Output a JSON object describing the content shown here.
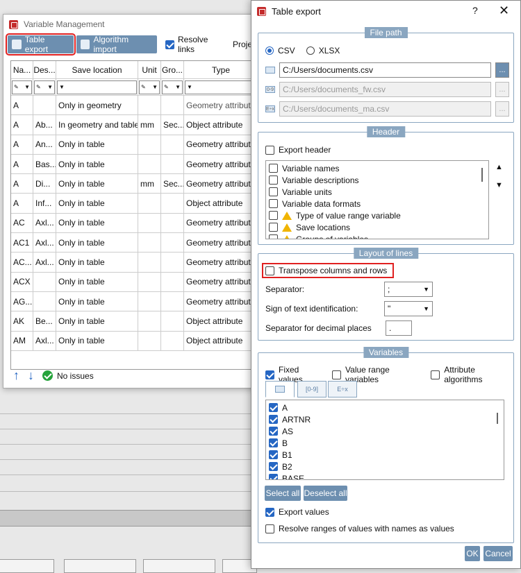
{
  "vm": {
    "title": "Variable Management",
    "toolbar": {
      "table_export": "Table export",
      "algorithm_import": "Algorithm import",
      "resolve_links": "Resolve links",
      "project": "Projec"
    },
    "columns": [
      "Na...",
      "Des...",
      "Save location",
      "Unit",
      "Gro...",
      "Type"
    ],
    "rows": [
      [
        "A",
        "",
        "Only in geometry",
        "",
        "",
        "Geometry attribute"
      ],
      [
        "A",
        "Ab...",
        "In geometry and table",
        "mm",
        "Sec...",
        "Object attribute"
      ],
      [
        "A",
        "An...",
        "Only in table",
        "",
        "",
        "Geometry attribute"
      ],
      [
        "A",
        "Bas...",
        "Only in table",
        "",
        "",
        "Geometry attribute"
      ],
      [
        "A",
        "Di...",
        "Only in table",
        "mm",
        "Sec...",
        "Geometry attribute"
      ],
      [
        "A",
        "Inf...",
        "Only in table",
        "",
        "",
        "Object attribute"
      ],
      [
        "AC",
        "Axl...",
        "Only in table",
        "",
        "",
        "Geometry attribute"
      ],
      [
        "AC1",
        "Axl...",
        "Only in table",
        "",
        "",
        "Geometry attribute"
      ],
      [
        "AC...",
        "Axl...",
        "Only in table",
        "",
        "",
        "Geometry attribute"
      ],
      [
        "ACX",
        "",
        "Only in table",
        "",
        "",
        "Geometry attribute"
      ],
      [
        "AG...",
        "",
        "Only in table",
        "",
        "",
        "Geometry attribute"
      ],
      [
        "AK",
        "Be...",
        "Only in table",
        "",
        "",
        "Object attribute"
      ],
      [
        "AM",
        "Axl...",
        "Only in table",
        "",
        "",
        "Object attribute"
      ]
    ],
    "status": "No issues",
    "up_arrow": "↑",
    "down_arrow": "↓"
  },
  "dialog": {
    "title": "Table export",
    "help": "?",
    "close": "✕",
    "file_path": {
      "legend": "File path",
      "csv": "CSV",
      "xlsx": "XLSX",
      "path1": "C:/Users/documents.csv",
      "path2": "C:/Users/documents_fw.csv",
      "path3": "C:/Users/documents_ma.csv",
      "browse": "..."
    },
    "header": {
      "legend": "Header",
      "export_header": "Export header",
      "items": [
        "Variable names",
        "Variable descriptions",
        "Variable units",
        "Variable data formats",
        "Type of value range variable",
        "Save locations",
        "Groups of variables"
      ]
    },
    "layout": {
      "legend": "Layout of lines",
      "transpose": "Transpose columns and rows",
      "separator_label": "Separator:",
      "separator_value": ";",
      "text_id_label": "Sign of text identification:",
      "text_id_value": "\"",
      "decimal_label": "Separator for decimal places",
      "decimal_value": "."
    },
    "variables": {
      "legend": "Variables",
      "fixed": "Fixed values",
      "range": "Value range variables",
      "algorithms": "Attribute algorithms",
      "tab2": "[0-9]",
      "tab3": "E÷x",
      "items": [
        "A",
        "ARTNR",
        "AS",
        "B",
        "B1",
        "B2",
        "BASE"
      ],
      "select_all": "Select all",
      "deselect_all": "Deselect all",
      "export_values": "Export values",
      "resolve_ranges": "Resolve ranges of values with names as values"
    },
    "ok": "OK",
    "cancel": "Cancel"
  },
  "colors": {
    "accent": "#6d8fb0",
    "check": "#2566c3",
    "highlight": "#e02020"
  }
}
